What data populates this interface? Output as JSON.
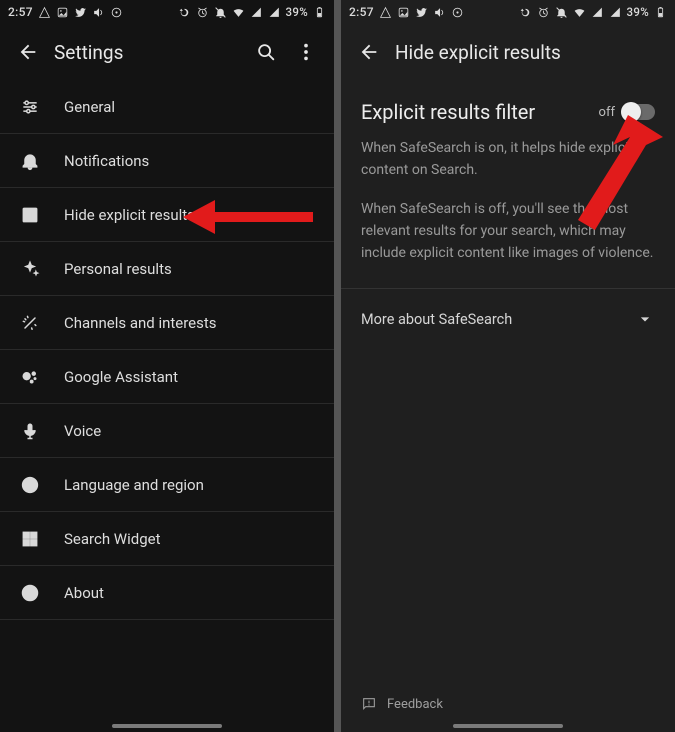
{
  "statusbar": {
    "time": "2:57",
    "battery_text": "39%"
  },
  "left": {
    "title": "Settings",
    "items": [
      {
        "icon": "sliders",
        "label": "General"
      },
      {
        "icon": "bell",
        "label": "Notifications"
      },
      {
        "icon": "e-box",
        "label": "Hide explicit results"
      },
      {
        "icon": "sparkle",
        "label": "Personal results"
      },
      {
        "icon": "wand",
        "label": "Channels and interests"
      },
      {
        "icon": "assist",
        "label": "Google Assistant"
      },
      {
        "icon": "mic",
        "label": "Voice"
      },
      {
        "icon": "globe",
        "label": "Language and region"
      },
      {
        "icon": "widget",
        "label": "Search Widget"
      },
      {
        "icon": "info",
        "label": "About"
      }
    ]
  },
  "right": {
    "title": "Hide explicit results",
    "section_title": "Explicit results filter",
    "toggle_state_label": "off",
    "paragraph1": "When SafeSearch is on, it helps hide explicit content on Search.",
    "paragraph2": "When SafeSearch is off, you'll see the most relevant results for your search, which may include explicit content like images of violence.",
    "expander_label": "More about SafeSearch",
    "feedback_label": "Feedback"
  }
}
